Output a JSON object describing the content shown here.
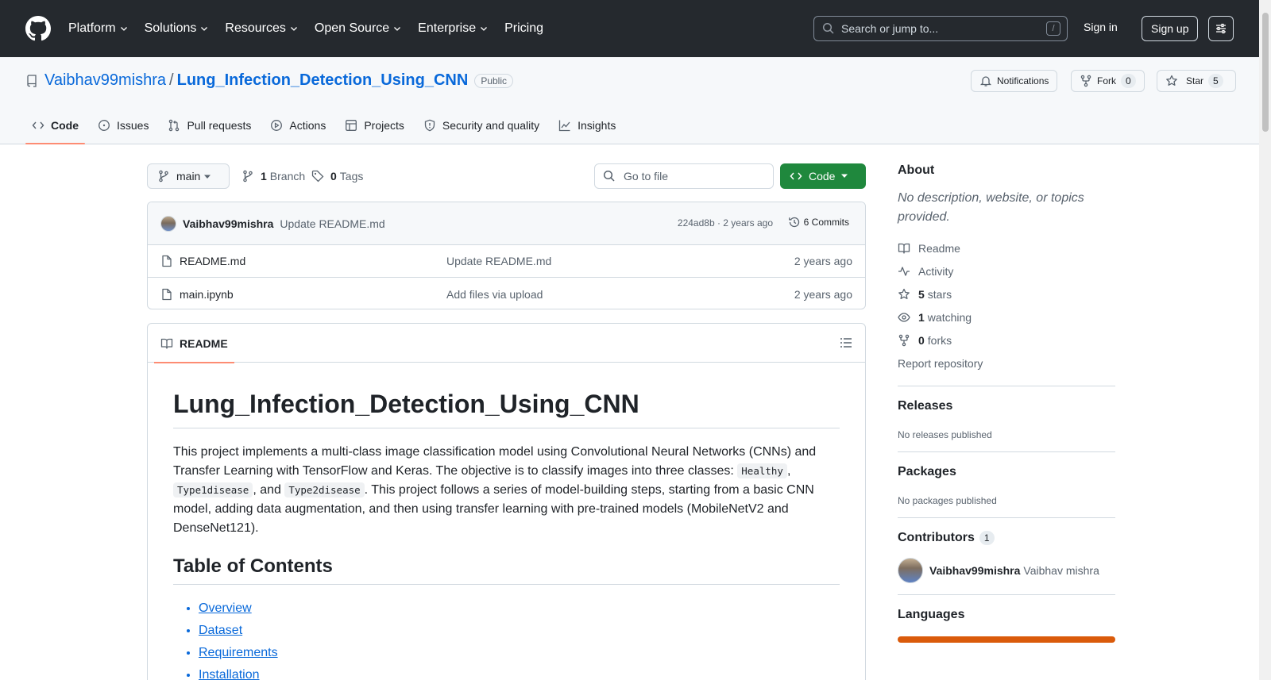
{
  "header": {
    "nav": [
      {
        "label": "Platform",
        "dropdown": true
      },
      {
        "label": "Solutions",
        "dropdown": true
      },
      {
        "label": "Resources",
        "dropdown": true
      },
      {
        "label": "Open Source",
        "dropdown": true
      },
      {
        "label": "Enterprise",
        "dropdown": true
      },
      {
        "label": "Pricing",
        "dropdown": false
      }
    ],
    "search_placeholder": "Search or jump to...",
    "search_key": "/",
    "signin": "Sign in",
    "signup": "Sign up"
  },
  "repo": {
    "owner": "Vaibhav99mishra",
    "separator": "/",
    "name": "Lung_Infection_Detection_Using_CNN",
    "visibility": "Public",
    "notifications": "Notifications",
    "fork_label": "Fork",
    "fork_count": "0",
    "star_label": "Star",
    "star_count": "5"
  },
  "tabs": [
    {
      "label": "Code",
      "icon": "code-icon",
      "active": true
    },
    {
      "label": "Issues",
      "icon": "issue-icon",
      "active": false
    },
    {
      "label": "Pull requests",
      "icon": "pull-request-icon",
      "active": false
    },
    {
      "label": "Actions",
      "icon": "play-icon",
      "active": false
    },
    {
      "label": "Projects",
      "icon": "table-icon",
      "active": false
    },
    {
      "label": "Security and quality",
      "icon": "shield-icon",
      "active": false
    },
    {
      "label": "Insights",
      "icon": "graph-icon",
      "active": false
    }
  ],
  "toolbar": {
    "branch": "main",
    "branches_count": "1",
    "branches_label": "Branch",
    "tags_count": "0",
    "tags_label": "Tags",
    "goto_placeholder": "Go to file",
    "code_button": "Code"
  },
  "commit": {
    "author": "Vaibhav99mishra",
    "message": "Update README.md",
    "sha_time": "224ad8b · 2 years ago",
    "commits_label": "6 Commits"
  },
  "files": [
    {
      "name": "README.md",
      "message": "Update README.md",
      "date": "2 years ago"
    },
    {
      "name": "main.ipynb",
      "message": "Add files via upload",
      "date": "2 years ago"
    }
  ],
  "readme": {
    "tab_label": "README",
    "title": "Lung_Infection_Detection_Using_CNN",
    "intro_1": "This project implements a multi-class image classification model using Convolutional Neural Networks (CNNs) and Transfer Learning with TensorFlow and Keras. The objective is to classify images into three classes: ",
    "code_1": "Healthy",
    "sep_1": ", ",
    "code_2": "Type1disease",
    "sep_2": ", and ",
    "code_3": "Type2disease",
    "intro_2": ". This project follows a series of model-building steps, starting from a basic CNN model, adding data augmentation, and then using transfer learning with pre-trained models (MobileNetV2 and DenseNet121).",
    "toc_title": "Table of Contents",
    "toc": [
      "Overview",
      "Dataset",
      "Requirements",
      "Installation"
    ]
  },
  "sidebar": {
    "about_title": "About",
    "about_desc": "No description, website, or topics provided.",
    "readme": "Readme",
    "activity": "Activity",
    "stars_count": "5",
    "stars_label": "stars",
    "watching_count": "1",
    "watching_label": "watching",
    "forks_count": "0",
    "forks_label": "forks",
    "report": "Report repository",
    "releases_title": "Releases",
    "releases_empty": "No releases published",
    "packages_title": "Packages",
    "packages_empty": "No packages published",
    "contributors_title": "Contributors",
    "contributors_count": "1",
    "contributor_login": "Vaibhav99mishra",
    "contributor_name": "Vaibhav mishra",
    "languages_title": "Languages"
  },
  "colors": {
    "header_bg": "#25292e",
    "link": "#0969da",
    "code_button": "#1f883d",
    "active_tab": "#fd8c73",
    "language_bar": "#da5b0b"
  }
}
